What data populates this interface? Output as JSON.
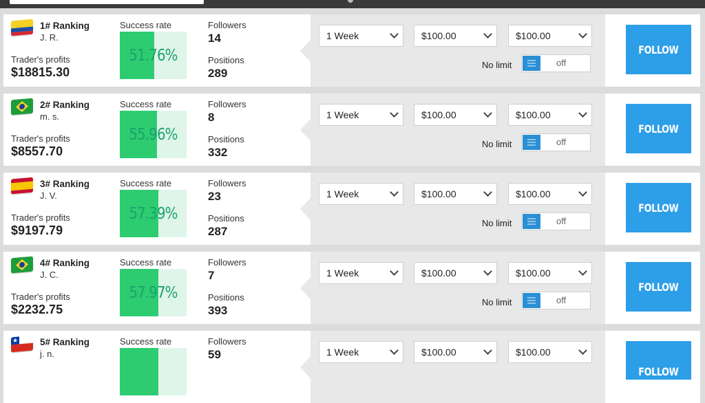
{
  "labels": {
    "success_rate": "Success rate",
    "followers": "Followers",
    "positions": "Positions",
    "traders_profits": "Trader's profits",
    "no_limit": "No limit",
    "follow_button": "FOLLOW"
  },
  "colors": {
    "success_fill": "#2ecc71",
    "success_track": "#dff5ea",
    "follow_button": "#2d9ee8",
    "toggle_knob": "#2a8fd4"
  },
  "traders": [
    {
      "flag_icon": "colombia-flag-icon",
      "rank": "1# Ranking",
      "name": "J. R.",
      "profit": "$18815.30",
      "success_rate_text": "51.76%",
      "success_rate": 0.5176,
      "followers": "14",
      "positions": "289",
      "period": "1 Week",
      "amount": "$100.00",
      "limit_amount": "$100.00",
      "no_limit_state": "off"
    },
    {
      "flag_icon": "brazil-flag-icon",
      "rank": "2# Ranking",
      "name": "m. s.",
      "profit": "$8557.70",
      "success_rate_text": "55.96%",
      "success_rate": 0.5596,
      "followers": "8",
      "positions": "332",
      "period": "1 Week",
      "amount": "$100.00",
      "limit_amount": "$100.00",
      "no_limit_state": "off"
    },
    {
      "flag_icon": "spain-flag-icon",
      "rank": "3# Ranking",
      "name": "J. V.",
      "profit": "$9197.79",
      "success_rate_text": "57.39%",
      "success_rate": 0.5739,
      "followers": "23",
      "positions": "287",
      "period": "1 Week",
      "amount": "$100.00",
      "limit_amount": "$100.00",
      "no_limit_state": "off"
    },
    {
      "flag_icon": "brazil-flag-icon",
      "rank": "4# Ranking",
      "name": "J. C.",
      "profit": "$2232.75",
      "success_rate_text": "57.97%",
      "success_rate": 0.5797,
      "followers": "7",
      "positions": "393",
      "period": "1 Week",
      "amount": "$100.00",
      "limit_amount": "$100.00",
      "no_limit_state": "off"
    },
    {
      "flag_icon": "chile-flag-icon",
      "rank": "5# Ranking",
      "name": "j. n.",
      "profit": "",
      "success_rate_text": "",
      "success_rate": 0.58,
      "followers": "59",
      "positions": "",
      "period": "1 Week",
      "amount": "$100.00",
      "limit_amount": "$100.00",
      "no_limit_state": ""
    }
  ]
}
